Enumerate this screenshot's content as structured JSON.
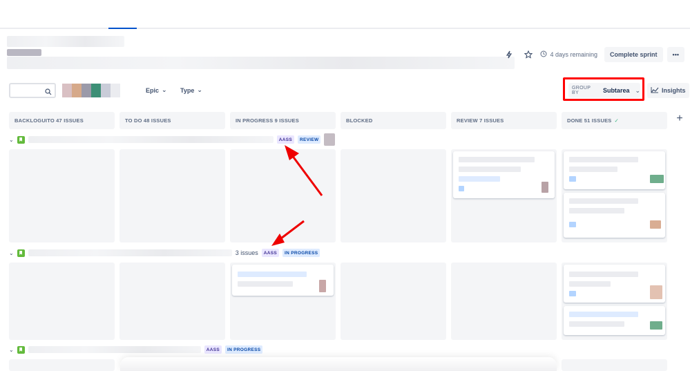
{
  "header": {
    "time_remaining": "4 days remaining",
    "complete_sprint_label": "Complete sprint",
    "more_label": "•••",
    "icons": [
      "lightning-icon",
      "star-icon",
      "clock-icon"
    ]
  },
  "filters": {
    "search_placeholder": "",
    "epic_label": "Epic",
    "type_label": "Type"
  },
  "group_by": {
    "label": "GROUP BY",
    "value": "Subtarea"
  },
  "insights_label": "Insights",
  "columns": [
    {
      "label": "BACKLOGUITO 47 ISSUES"
    },
    {
      "label": "TO DO 48 ISSUES"
    },
    {
      "label": "IN PROGRESS 9 ISSUES"
    },
    {
      "label": "BLOCKED"
    },
    {
      "label": "REVIEW 7 ISSUES"
    },
    {
      "label": "DONE 51 ISSUES",
      "check": "✓"
    }
  ],
  "add_column_label": "+",
  "swimlanes": [
    {
      "epic": "AASS",
      "status": "REVIEW",
      "count": ""
    },
    {
      "epic": "AASS",
      "status": "IN PROGRESS",
      "count": "3 issues"
    },
    {
      "epic": "AASS",
      "status": "IN PROGRESS",
      "count": ""
    }
  ],
  "colors": {
    "highlight": "#ff0000",
    "story": "#63ba3c",
    "epic_bg": "#eae6ff",
    "status_bg": "#deebff"
  }
}
